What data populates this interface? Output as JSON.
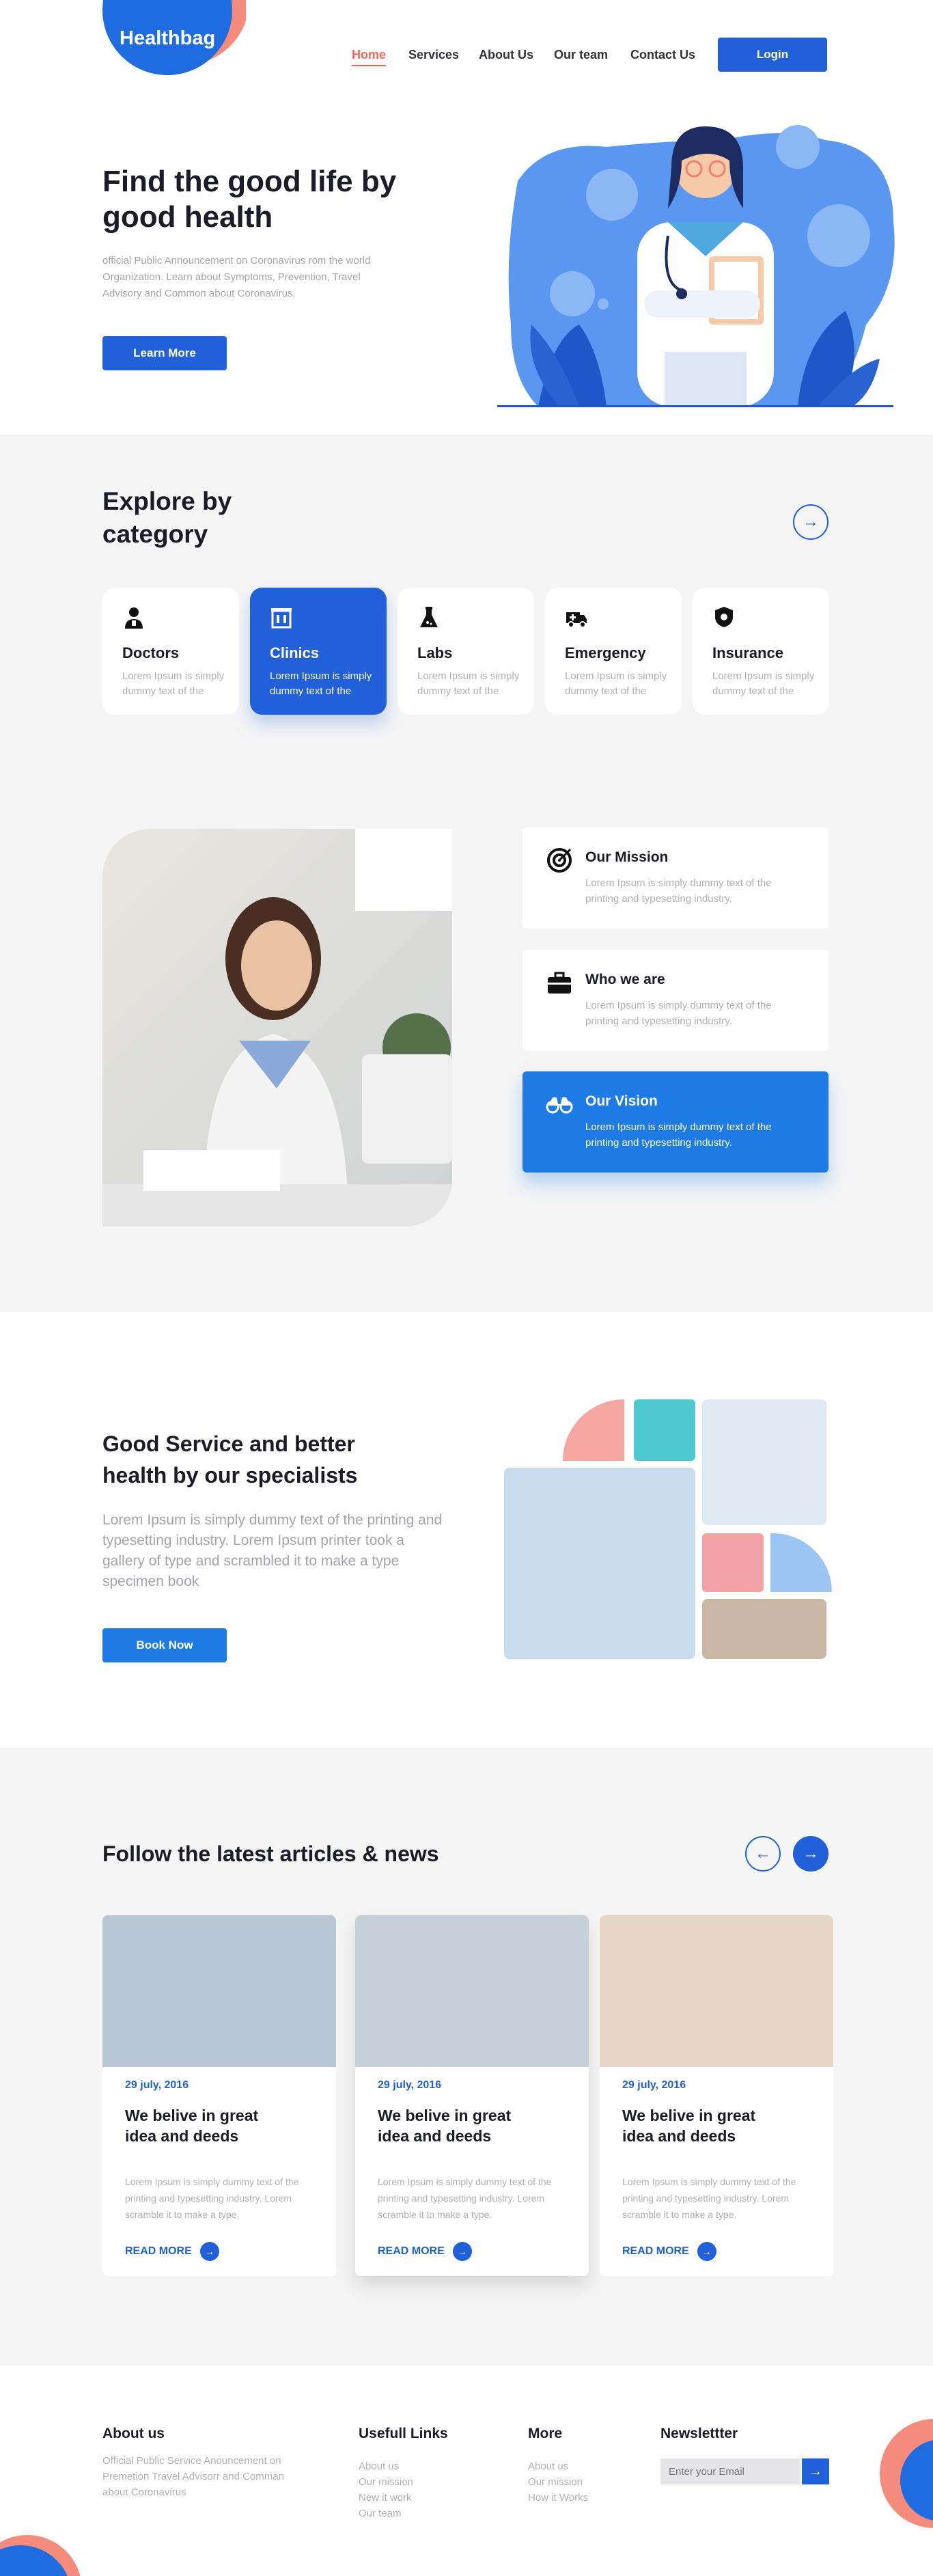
{
  "brand": {
    "name": "Healthbag"
  },
  "nav": {
    "items": [
      "Home",
      "Services",
      "About Us",
      "Our team",
      "Contact Us"
    ],
    "login": "Login"
  },
  "hero": {
    "title": "Find the good life by good health",
    "description": "official Public Announcement on Coronavirus rom the world Organization. Learn about Symptoms, Prevention, Travel Advisory and Common about Coronavirus.",
    "cta": "Learn More"
  },
  "categories": {
    "title": "Explore by category",
    "items": [
      {
        "name": "Doctors",
        "desc": "Lorem Ipsum is simply dummy text of the",
        "icon": "doctor-icon"
      },
      {
        "name": "Clinics",
        "desc": "Lorem Ipsum is simply dummy text of the",
        "icon": "clinic-icon"
      },
      {
        "name": "Labs",
        "desc": "Lorem Ipsum is simply dummy text of the",
        "icon": "flask-icon"
      },
      {
        "name": "Emergency",
        "desc": "Lorem Ipsum is simply dummy text of the",
        "icon": "ambulance-icon"
      },
      {
        "name": "Insurance",
        "desc": "Lorem Ipsum is simply dummy text of the",
        "icon": "shield-icon"
      }
    ]
  },
  "about": {
    "items": [
      {
        "title": "Our Mission",
        "desc": "Lorem Ipsum is simply dummy text of the printing and typesetting industry.",
        "icon": "target-icon"
      },
      {
        "title": "Who we are",
        "desc": "Lorem Ipsum is simply dummy text of the printing and typesetting industry.",
        "icon": "briefcase-icon"
      },
      {
        "title": "Our Vision",
        "desc": "Lorem Ipsum is simply dummy text of the printing and typesetting industry.",
        "icon": "binoculars-icon"
      }
    ]
  },
  "service": {
    "title": "Good Service and better health by our specialists",
    "description": "Lorem Ipsum is simply dummy text of the printing and typesetting industry. Lorem Ipsum printer took a gallery of type and scrambled it to make a type specimen book",
    "cta": "Book Now"
  },
  "news": {
    "title": "Follow the latest articles & news",
    "articles": [
      {
        "date": "29 july, 2016",
        "title": "We belive in great idea and deeds",
        "desc": "Lorem Ipsum is simply dummy text of the printing and typesetting industry. Lorem scramble it to make a type.",
        "cta": "READ MORE"
      },
      {
        "date": "29 july, 2016",
        "title": "We belive in great idea and deeds",
        "desc": "Lorem Ipsum is simply dummy text of the printing and typesetting industry. Lorem scramble it to make a type.",
        "cta": "READ MORE"
      },
      {
        "date": "29 july, 2016",
        "title": "We belive in great idea and deeds",
        "desc": "Lorem Ipsum is simply dummy text of the printing and typesetting industry. Lorem scramble it to make a type.",
        "cta": "READ MORE"
      }
    ]
  },
  "footer": {
    "about": {
      "title": "About us",
      "text": "Official Public Service Anouncement on Premetion Travel Advisorr and Comman about Coronavirus"
    },
    "useful": {
      "title": "Usefull Links",
      "links": [
        "About us",
        "Our mission",
        "New it work",
        "Our team"
      ]
    },
    "more": {
      "title": "More",
      "links": [
        "About us",
        "Our mission",
        "How it Works"
      ]
    },
    "newsletter": {
      "title": "Newslettter",
      "placeholder": "Enter your Email"
    }
  },
  "colors": {
    "primary": "#2160d8",
    "accent": "#f0685a",
    "light_blue": "#1e7be5",
    "band": "#f5f5f6"
  }
}
